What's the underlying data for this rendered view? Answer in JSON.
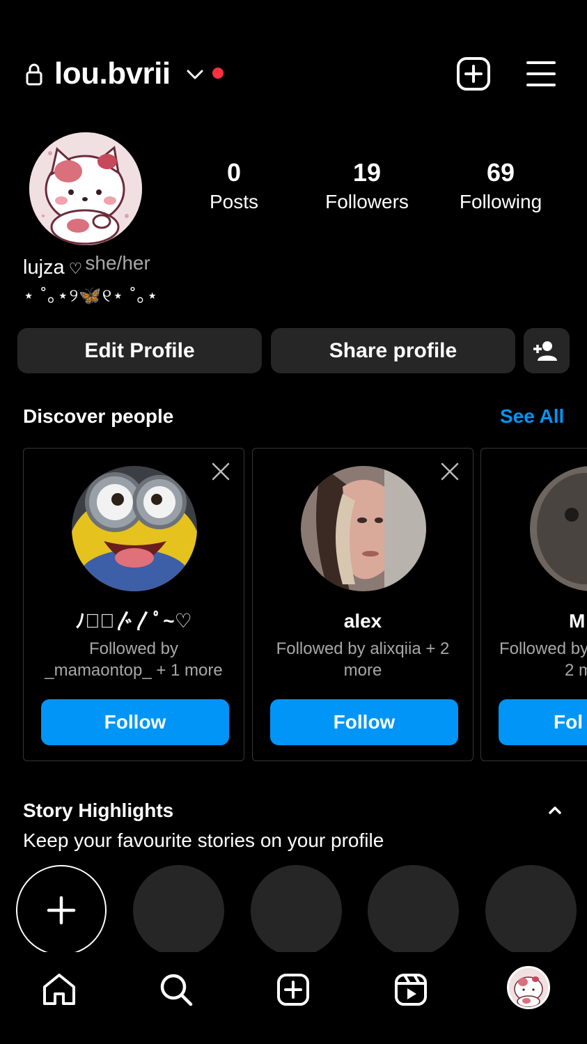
{
  "header": {
    "username": "lou.bvrii",
    "icons": [
      "lock-icon",
      "chevron-down-icon",
      "notification-dot",
      "new-post-icon",
      "menu-icon"
    ],
    "dot_color": "#ff3040"
  },
  "profile": {
    "stats": [
      {
        "value": "0",
        "label": "Posts"
      },
      {
        "value": "19",
        "label": "Followers"
      },
      {
        "value": "69",
        "label": "Following"
      }
    ],
    "name": "lujza",
    "name_symbol": "♡",
    "pronouns": "she/her",
    "bio": "⋆ ˚｡⋆୨🦋୧⋆ ˚｡⋆"
  },
  "actions": {
    "edit_profile": "Edit Profile",
    "share_profile": "Share profile",
    "add_person_icon": "person-add-icon"
  },
  "discover": {
    "title": "Discover people",
    "see_all": "See All",
    "accent": "#0095f6",
    "cards": [
      {
        "name": "ﾉ𝄞ﾟ〴〳ﾟ~♡",
        "followed_by": "Followed by _mamaontop_ + 1 more",
        "follow": "Follow"
      },
      {
        "name": "alex",
        "followed_by": "Followed by alixqiia + 2 more",
        "follow": "Follow"
      },
      {
        "name": "M",
        "followed_by": "Followed by",
        "followed_by_2": "2 m",
        "follow": "Fol"
      }
    ]
  },
  "highlights": {
    "title": "Story Highlights",
    "subtitle": "Keep your favourite stories on your profile"
  },
  "nav": {
    "items": [
      "home-icon",
      "search-icon",
      "create-icon",
      "reels-icon",
      "profile-avatar"
    ]
  }
}
